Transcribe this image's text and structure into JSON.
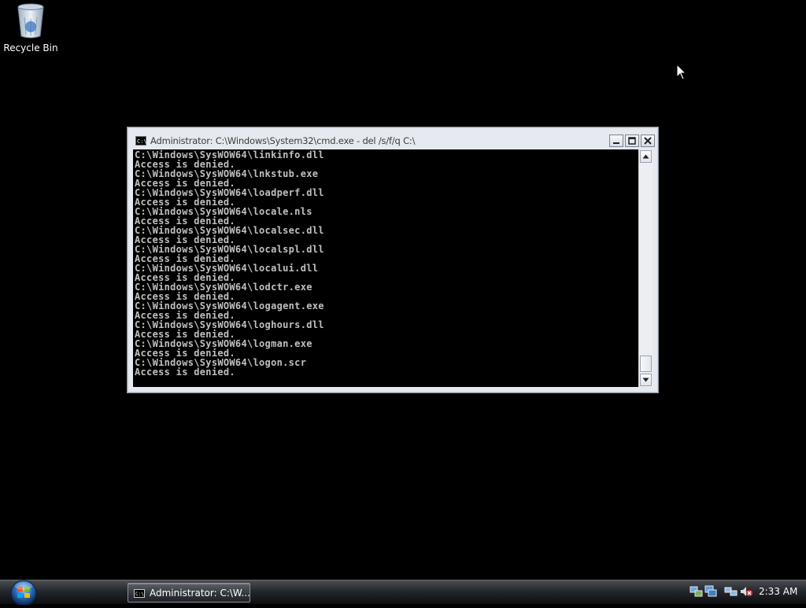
{
  "desktop": {
    "icons": [
      {
        "label": "Recycle Bin",
        "icon": "recycle-bin-icon"
      }
    ]
  },
  "window": {
    "title": "Administrator: C:\\Windows\\System32\\cmd.exe - del  /s/f/q C:\\",
    "icon": "cmd-icon",
    "buttons": {
      "minimize": "minimize-icon",
      "maximize": "maximize-icon",
      "close": "close-icon"
    },
    "console": {
      "text_color": "#c0c0c0",
      "background": "#000000",
      "lines": [
        "C:\\Windows\\SysWOW64\\linkinfo.dll",
        "Access is denied.",
        "C:\\Windows\\SysWOW64\\lnkstub.exe",
        "Access is denied.",
        "C:\\Windows\\SysWOW64\\loadperf.dll",
        "Access is denied.",
        "C:\\Windows\\SysWOW64\\locale.nls",
        "Access is denied.",
        "C:\\Windows\\SysWOW64\\localsec.dll",
        "Access is denied.",
        "C:\\Windows\\SysWOW64\\localspl.dll",
        "Access is denied.",
        "C:\\Windows\\SysWOW64\\localui.dll",
        "Access is denied.",
        "C:\\Windows\\SysWOW64\\lodctr.exe",
        "Access is denied.",
        "C:\\Windows\\SysWOW64\\logagent.exe",
        "Access is denied.",
        "C:\\Windows\\SysWOW64\\loghours.dll",
        "Access is denied.",
        "C:\\Windows\\SysWOW64\\logman.exe",
        "Access is denied.",
        "C:\\Windows\\SysWOW64\\logon.scr",
        "Access is denied."
      ]
    }
  },
  "taskbar": {
    "start_icon": "windows-start-orb-icon",
    "tasks": [
      {
        "label": "Administrator: C:\\W...",
        "icon": "cmd-icon"
      }
    ],
    "tray": {
      "icons": [
        "network-activity-icon",
        "network-icon",
        "network-connections-icon",
        "volume-muted-icon"
      ],
      "clock": "2:33 AM"
    }
  }
}
